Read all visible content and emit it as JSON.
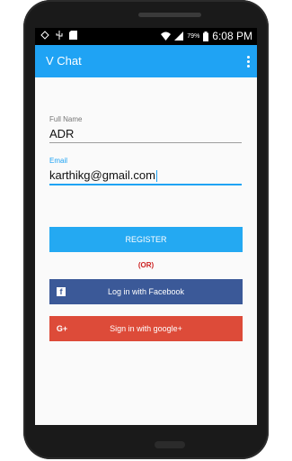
{
  "status_bar": {
    "battery_percent": "79%",
    "time": "6:08 PM"
  },
  "app_bar": {
    "title": "V Chat"
  },
  "form": {
    "full_name_label": "Full Name",
    "full_name_value": "ADR",
    "email_label": "Email",
    "email_value": "karthikg@gmail.com"
  },
  "buttons": {
    "register_label": "REGISTER",
    "or_text": "(OR)",
    "facebook_label": "Log in with Facebook",
    "facebook_icon": "f",
    "google_label": "Sign in with google+",
    "google_icon": "G+"
  },
  "colors": {
    "accent": "#1fa3f4",
    "facebook": "#3b5998",
    "google": "#dd4b39",
    "or_text": "#cc1f1f"
  }
}
